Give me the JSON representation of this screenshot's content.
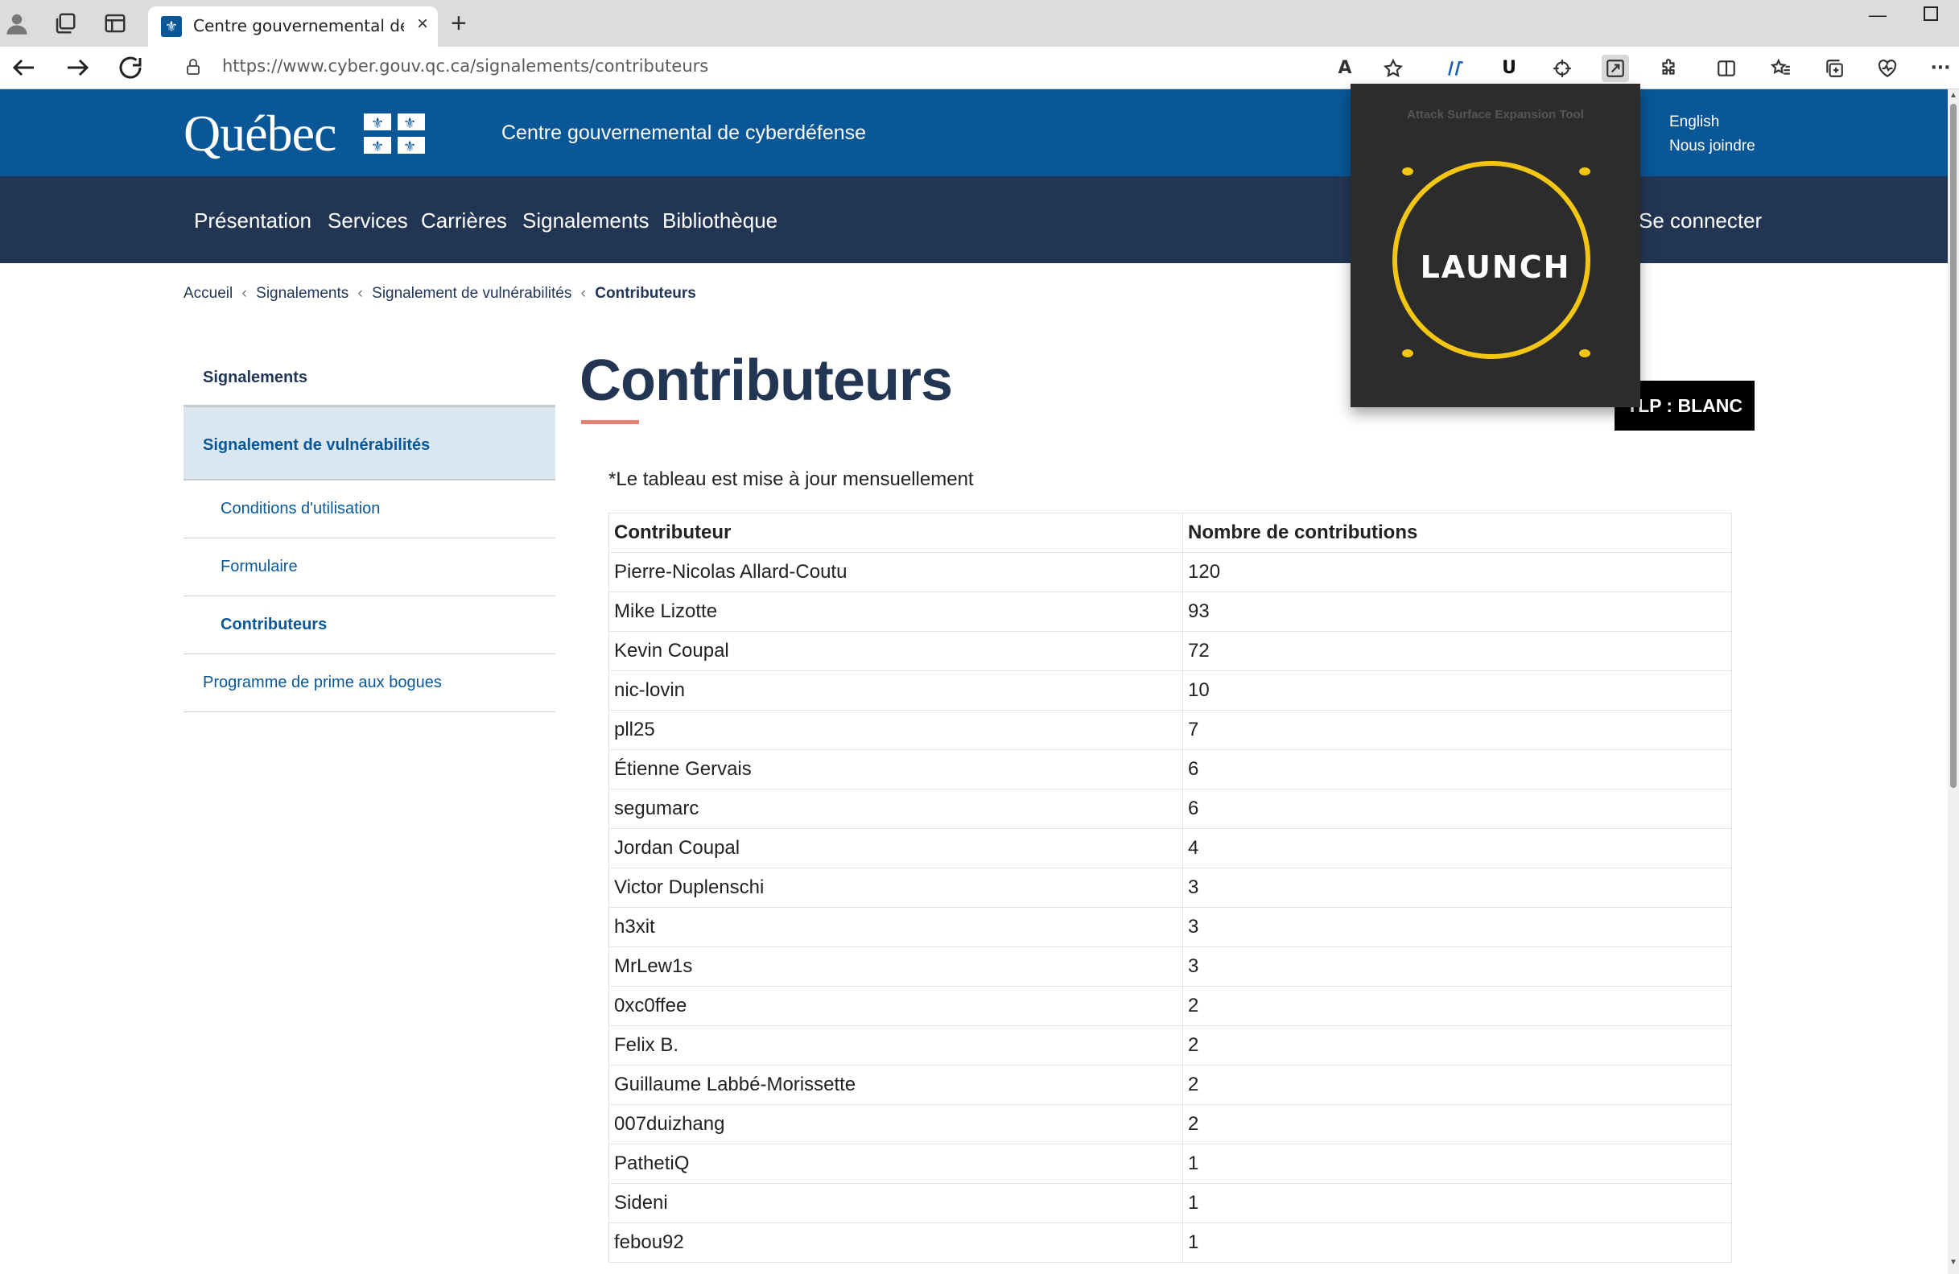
{
  "browser": {
    "tab_title": "Centre gouvernemental de cyber",
    "tab_close": "×",
    "new_tab": "+",
    "url": "https://www.cyber.gouv.qc.ca/signalements/contributeurs",
    "win_min": "—",
    "read_aloud": "A",
    "ext_u": "U",
    "icons": [
      "profile-icon",
      "workspaces-icon",
      "tab-actions-icon",
      "back-icon",
      "forward-icon",
      "refresh-icon",
      "lock-icon",
      "read-aloud-icon",
      "favorite-icon",
      "extension-icon",
      "crosshair-icon",
      "launch-ext-icon",
      "puzzle-icon",
      "split-screen-icon",
      "favorites-list-icon",
      "collections-icon",
      "browser-essentials-icon",
      "more-icon"
    ]
  },
  "header": {
    "logo_text": "Québec",
    "site_name": "Centre gouvernemental de cyberdéfense",
    "lang": "English",
    "contact": "Nous joindre"
  },
  "nav": {
    "items": [
      "Présentation",
      "Services",
      "Carrières",
      "Signalements",
      "Bibliothèque"
    ],
    "login": "Se connecter"
  },
  "breadcrumb": {
    "items": [
      "Accueil",
      "Signalements",
      "Signalement de vulnérabilités"
    ],
    "current": "Contributeurs",
    "sep": "‹"
  },
  "sidebar": {
    "title": "Signalements",
    "active": "Signalement de vulnérabilités",
    "subs": [
      "Conditions d'utilisation",
      "Formulaire",
      "Contributeurs"
    ],
    "bounty": "Programme de prime aux bogues"
  },
  "main": {
    "title": "Contributeurs",
    "tlp": "TLP : BLANC",
    "note": "*Le tableau est mise à jour mensuellement",
    "table": {
      "headers": [
        "Contributeur",
        "Nombre de contributions"
      ],
      "rows": [
        [
          "Pierre-Nicolas Allard-Coutu",
          "120"
        ],
        [
          "Mike Lizotte",
          "93"
        ],
        [
          "Kevin Coupal",
          "72"
        ],
        [
          "nic-lovin",
          "10"
        ],
        [
          "pll25",
          "7"
        ],
        [
          "Étienne Gervais",
          "6"
        ],
        [
          "segumarc",
          "6"
        ],
        [
          "Jordan Coupal",
          "4"
        ],
        [
          "Victor Duplenschi",
          "3"
        ],
        [
          "h3xit",
          "3"
        ],
        [
          "MrLew1s",
          "3"
        ],
        [
          "0xc0ffee",
          "2"
        ],
        [
          "Felix B.",
          "2"
        ],
        [
          "Guillaume Labbé-Morissette",
          "2"
        ],
        [
          "007duizhang",
          "2"
        ],
        [
          "PathetiQ",
          "1"
        ],
        [
          "Sideni",
          "1"
        ],
        [
          "febou92",
          "1"
        ]
      ]
    }
  },
  "extension": {
    "title": "Attack Surface Expansion Tool",
    "button": "LAUNCH",
    "accent": "#f3c614"
  },
  "colors": {
    "header_blue": "#095797",
    "nav_dark": "#223654",
    "accent_red": "#e58271"
  }
}
